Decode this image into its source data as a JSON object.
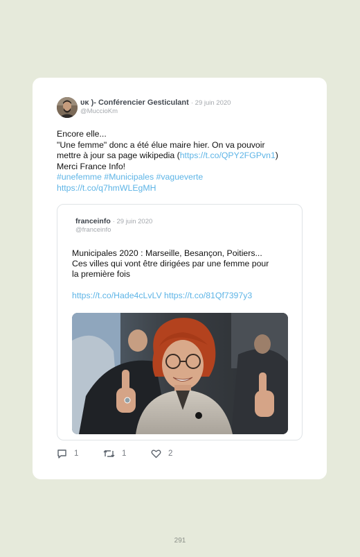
{
  "tweet": {
    "author_name": "ᴜᴋ )- Conférencier Gesticulant",
    "date": "· 29 juin 2020",
    "handle": "@MuccioKm",
    "lines": [
      "Encore elle...",
      "\"Une femme\" donc a été élue maire hier. On va pouvoir",
      "mettre à jour sa page wikipedia (",
      "https://t.co/QPY2FGPvn1",
      ")",
      "Merci France Info!",
      "#unefemme #Municipales #vagueverte",
      "https://t.co/q7hmWLEgMH"
    ]
  },
  "quoted": {
    "author_name": "franceinfo",
    "date": "· 29 juin 2020",
    "handle": "@franceinfo",
    "lines": [
      "Municipales 2020 : Marseille, Besançon, Poitiers...",
      "Ces villes qui vont être dirigées par une femme pour",
      "la première fois"
    ],
    "links": "https://t.co/Hade4cLvLV https://t.co/81Qf7397y3"
  },
  "actions": {
    "reply_count": "1",
    "retweet_count": "1",
    "like_count": "2"
  },
  "page_number": "291"
}
